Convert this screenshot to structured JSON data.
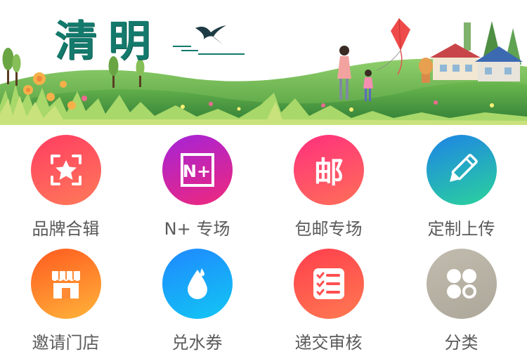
{
  "banner": {
    "title": "清明",
    "icon": "swallow-bird"
  },
  "grid": {
    "items": [
      {
        "label": "品牌合辑",
        "icon": "star-frame-icon",
        "color_from": "#ff3d62",
        "color_to": "#ff7a59"
      },
      {
        "label": "N+ 专场",
        "icon": "n-plus-icon",
        "glyph": "N+",
        "color_from": "#a423d9",
        "color_to": "#f0287b"
      },
      {
        "label": "包邮专场",
        "icon": "mail-icon",
        "glyph": "邮",
        "color_from": "#ff2f7e",
        "color_to": "#ff6f57"
      },
      {
        "label": "定制上传",
        "icon": "pencil-icon",
        "color_from": "#1e83e6",
        "color_to": "#2bd39b"
      },
      {
        "label": "邀请门店",
        "icon": "storefront-icon",
        "color_from": "#ff5a1f",
        "color_to": "#ffb43a"
      },
      {
        "label": "兑水券",
        "icon": "water-drop-icon",
        "color_from": "#1f88ff",
        "color_to": "#12c7f3"
      },
      {
        "label": "递交审核",
        "icon": "checklist-icon",
        "color_from": "#ff3e4e",
        "color_to": "#ff7a50"
      },
      {
        "label": "分类",
        "icon": "category-grid-icon",
        "color_from": "#c2bcaf",
        "color_to": "#ada79a"
      }
    ]
  }
}
